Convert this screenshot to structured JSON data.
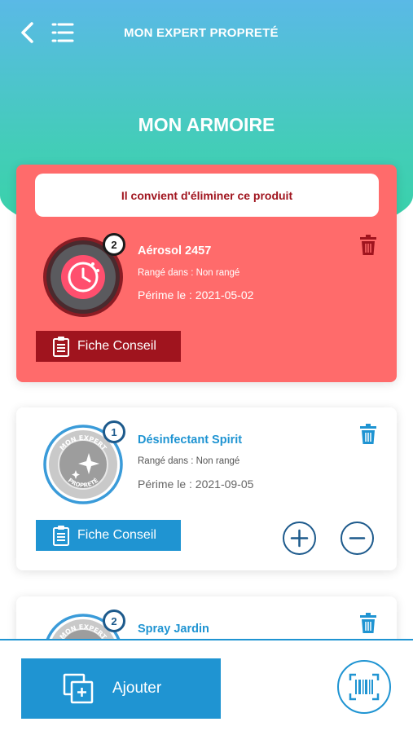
{
  "header": {
    "app_title": "MON EXPERT PROPRETÉ",
    "page_title": "MON ARMOIRE",
    "back_icon": "chevron-left-icon",
    "menu_icon": "hamburger-icon"
  },
  "colors": {
    "gradient_top": "#5ab9e6",
    "gradient_bottom": "#36d3a6",
    "alert_bg": "#ff6b6b",
    "alert_dark": "#a0141e",
    "accent_blue": "#1f94d2",
    "navy": "#1d5a8c"
  },
  "products": [
    {
      "status": "expired",
      "alert": "Il convient d'éliminer ce produit",
      "badge": "2",
      "name": "Aérosol 2457",
      "location": "Rangé dans : Non rangé",
      "expiry": "Périme le : 2021-05-02",
      "fiche_label": "Fiche Conseil",
      "icon": "timer-icon"
    },
    {
      "status": "ok",
      "badge": "1",
      "name": "Désinfectant Spirit",
      "location": "Rangé dans : Non rangé",
      "expiry": "Périme le : 2021-09-05",
      "fiche_label": "Fiche Conseil",
      "icon": "sparkle-icon",
      "seal_top": "MON EXPERT",
      "seal_bottom": "PROPRETÉ"
    },
    {
      "status": "ok",
      "badge": "2",
      "name": "Spray Jardin",
      "seal_top": "MON EXPERT"
    }
  ],
  "footer": {
    "add_label": "Ajouter",
    "add_icon": "add-copy-icon",
    "scan_icon": "barcode-scan-icon"
  }
}
